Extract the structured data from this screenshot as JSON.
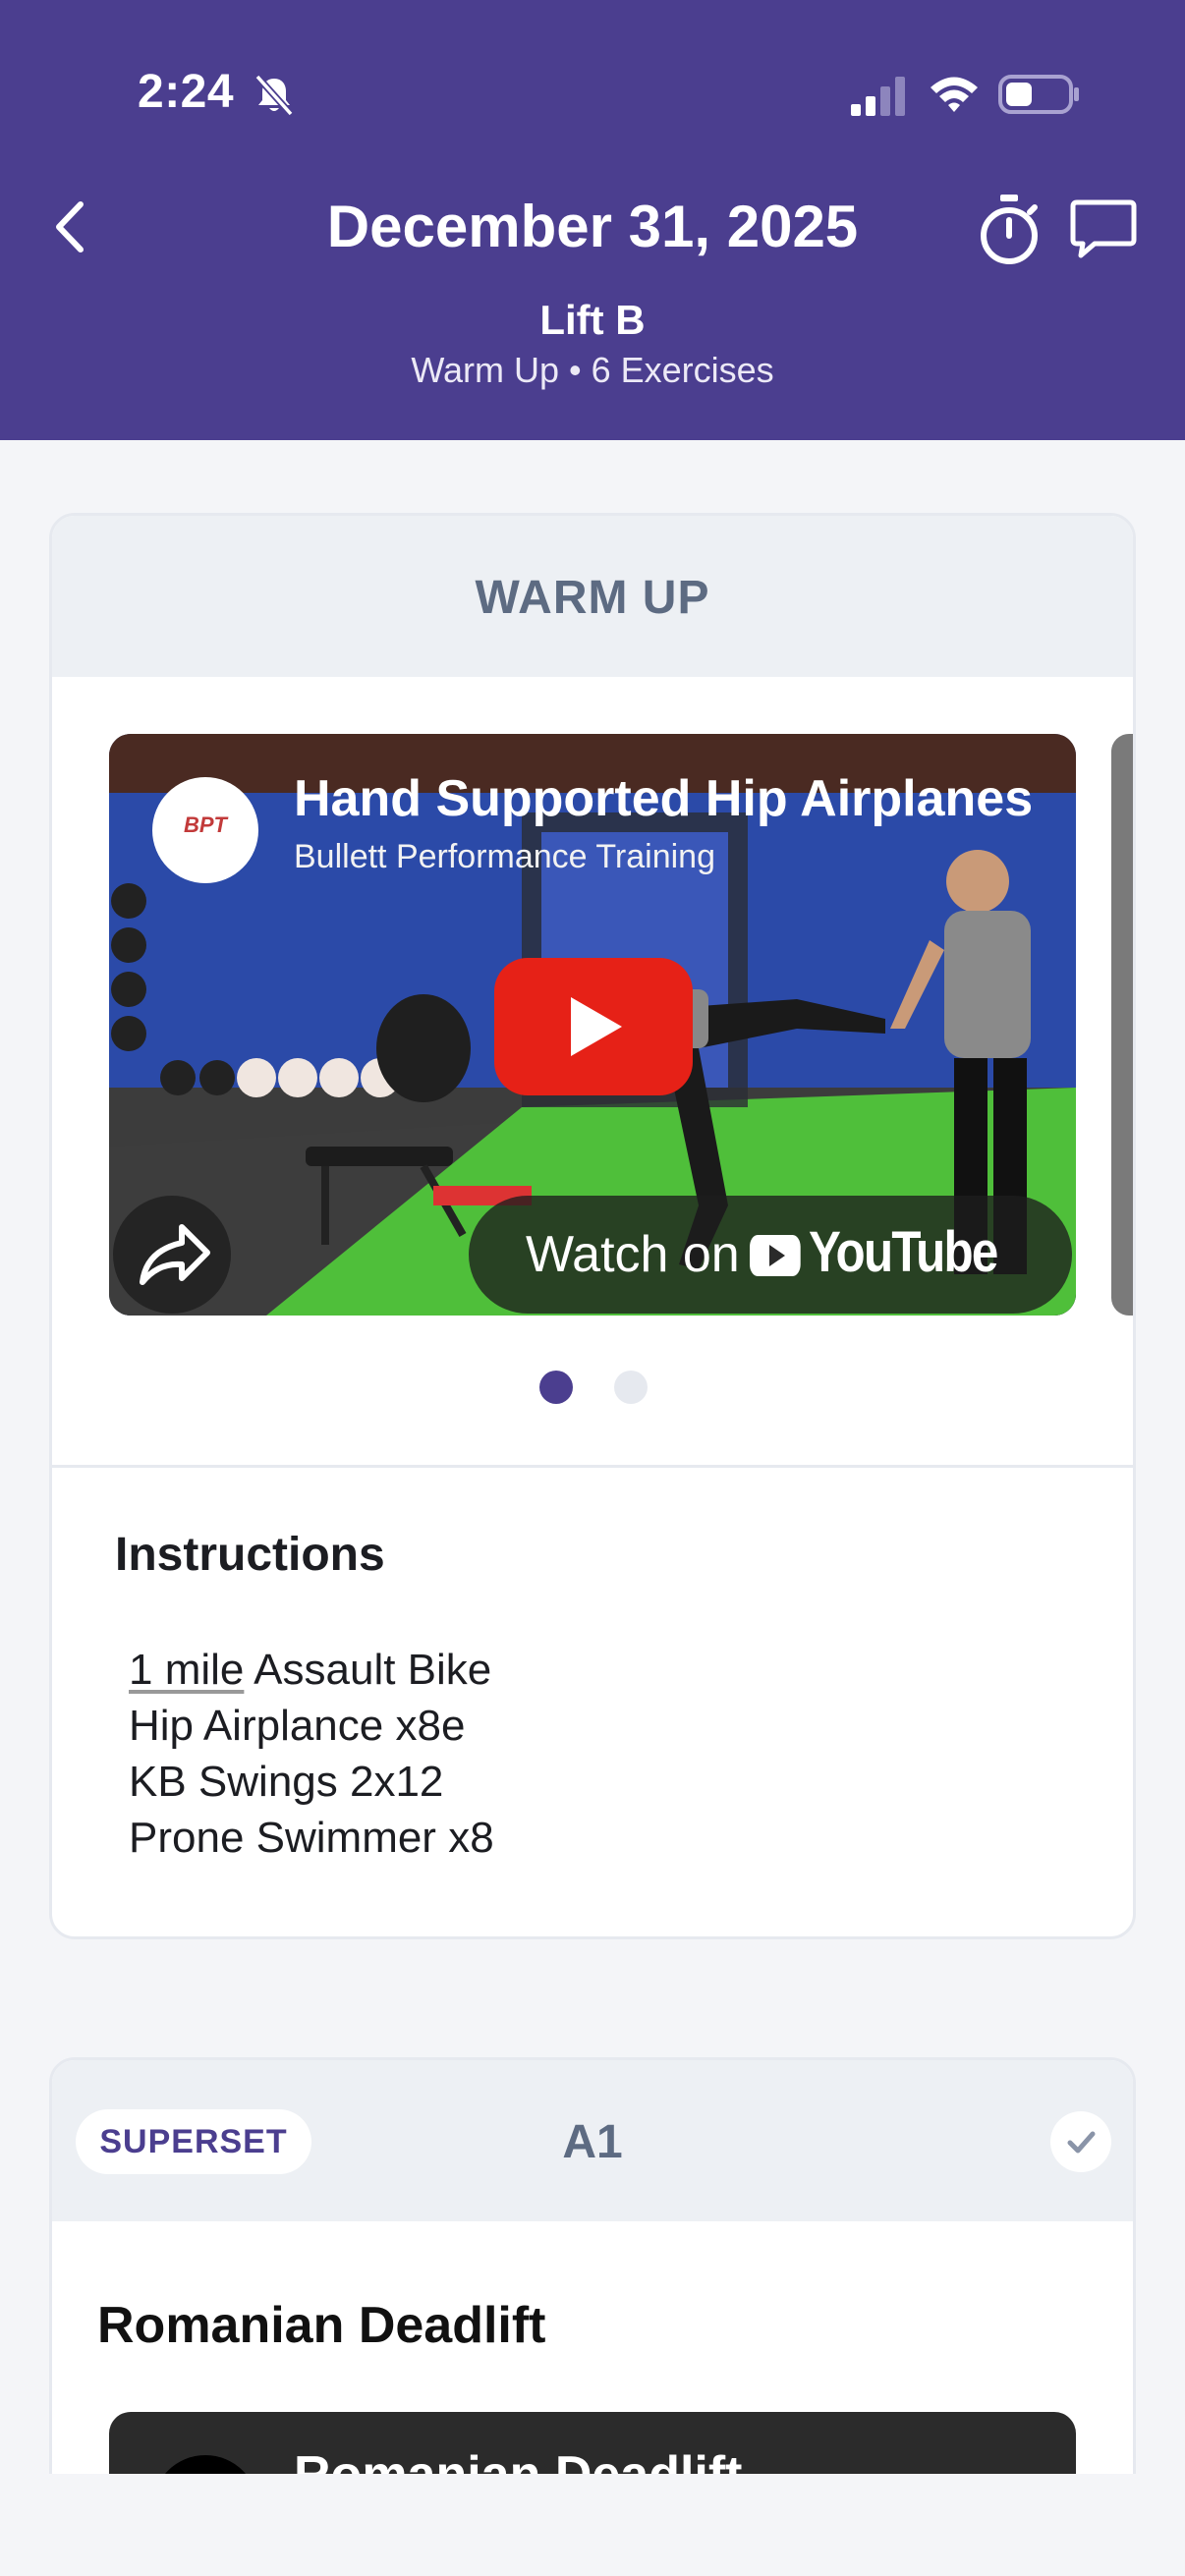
{
  "status_bar": {
    "time": "2:24"
  },
  "header": {
    "title": "December 31, 2025",
    "workout_name": "Lift B",
    "summary": "Warm Up • 6 Exercises",
    "background_color": "#4b3e8f"
  },
  "warmup_card": {
    "section_title": "WARM UP",
    "video": {
      "title": "Hand Supported Hip Airplanes",
      "channel": "Bullett Performance Training",
      "channel_logo_text": "BPT",
      "watch_on_label": "Watch on",
      "youtube_label": "YouTube"
    },
    "carousel_pages": 2,
    "carousel_active_index": 0,
    "instructions_heading": "Instructions",
    "instructions": [
      {
        "underlined": "1 mile",
        "rest": " Assault Bike"
      },
      {
        "underlined": "",
        "rest": "Hip Airplance x8e"
      },
      {
        "underlined": "",
        "rest": "KB Swings 2x12"
      },
      {
        "underlined": "",
        "rest": "Prone Swimmer x8"
      }
    ]
  },
  "exercise_card": {
    "badge": "SUPERSET",
    "label": "A1",
    "exercise_name": "Romanian Deadlift",
    "video_title": "Romanian Deadlift"
  },
  "colors": {
    "accent": "#4b3e8f",
    "youtube_red": "#e62117",
    "section_header_bg": "#edf0f4"
  }
}
